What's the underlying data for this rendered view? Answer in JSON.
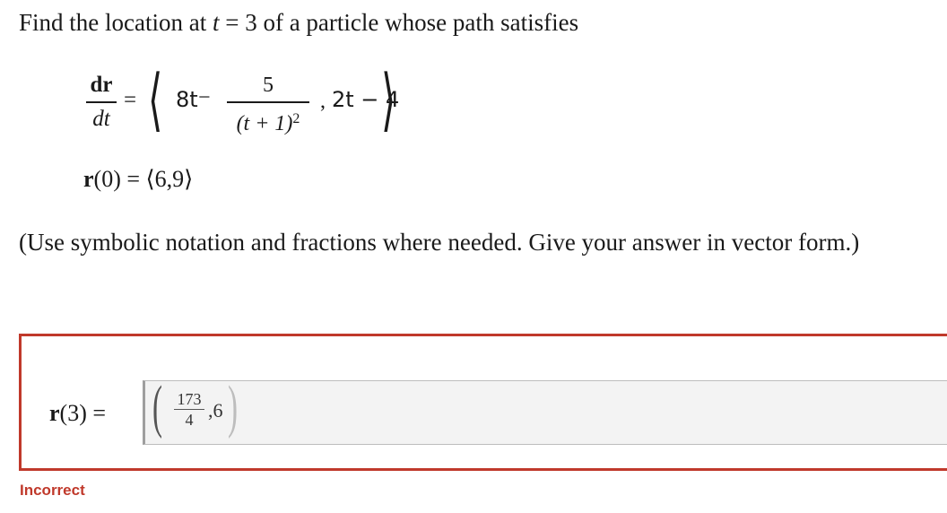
{
  "question": {
    "prefix": "Find the location at ",
    "var": "t",
    "suffix": " = 3 of a particle whose path satisfies"
  },
  "equation": {
    "lhs_num": "dr",
    "lhs_den": "dt",
    "equals": "=",
    "left_bracket": "⟨",
    "right_bracket": "⟩",
    "first_term": "8t",
    "minus": "−",
    "frac_num": "5",
    "frac_den_base": "(t + 1)",
    "frac_den_exp": "2",
    "comma": ",",
    "second_term": "2t − 4"
  },
  "initial_condition": {
    "func": "r",
    "rest": "(0) = ⟨6,9⟩"
  },
  "instructions": "(Use symbolic notation and fractions where needed. Give your answer in vector form.)",
  "answer": {
    "label_func": "r",
    "label_rest": "(3) =",
    "left_bracket": "(",
    "right_bracket": ")",
    "frac_num": "173",
    "frac_den": "4",
    "rest": ",6"
  },
  "status": {
    "text": "Incorrect",
    "color": "#c0392b"
  },
  "colors": {
    "error_border": "#c0392b",
    "input_background": "#f3f3f3"
  }
}
